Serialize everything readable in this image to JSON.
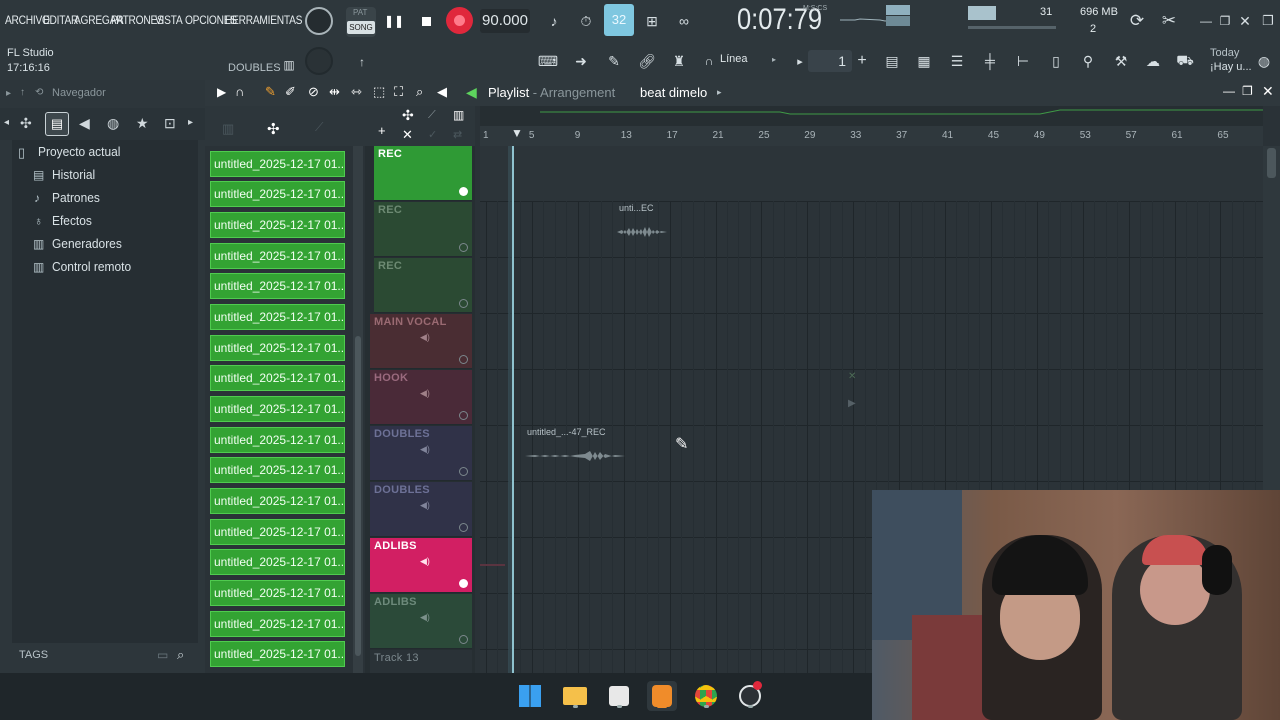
{
  "menu": [
    "ARCHIVO",
    "EDITAR",
    "AGREGAR",
    "PATRONES",
    "VISTA",
    "OPCIONES",
    "HERRAMIENTAS"
  ],
  "transport": {
    "pat": "PAT",
    "song": "SONG",
    "tempo": "90.000",
    "time": "0:07:79",
    "time_label": "M:S:CS",
    "pattern_num": "32"
  },
  "info": {
    "cpu": "31",
    "mem": "696 MB",
    "voices": "2"
  },
  "app": {
    "name": "FL Studio",
    "clock": "17:16:16",
    "hint_label": "DOUBLES"
  },
  "toolbar2": {
    "snap": "Línea",
    "num": "1",
    "today": "Today",
    "hint": "¡Hay u..."
  },
  "browser": {
    "title": "Navegador",
    "items": [
      "Proyecto actual",
      "Historial",
      "Patrones",
      "Efectos",
      "Generadores",
      "Control remoto"
    ],
    "tags": "TAGS"
  },
  "playlist": {
    "title": "Playlist",
    "sep": " - ",
    "section": "Arrangement",
    "pattern": "beat dimelo"
  },
  "ruler": [
    "1",
    "5",
    "9",
    "13",
    "17",
    "21",
    "25",
    "29",
    "33",
    "37",
    "41",
    "45",
    "49",
    "53",
    "57",
    "61",
    "65"
  ],
  "patterns": [
    "untitled_2025-12-17 01...",
    "untitled_2025-12-17 01...",
    "untitled_2025-12-17 01...",
    "untitled_2025-12-17 01...",
    "untitled_2025-12-17 01...",
    "untitled_2025-12-17 01...",
    "untitled_2025-12-17 01...",
    "untitled_2025-12-17 01...",
    "untitled_2025-12-17 01...",
    "untitled_2025-12-17 01...",
    "untitled_2025-12-17 01...",
    "untitled_2025-12-17 01...",
    "untitled_2025-12-17 01...",
    "untitled_2025-12-17 01...",
    "untitled_2025-12-17 01...",
    "untitled_2025-12-17 01...",
    "untitled_2025-12-17 01..."
  ],
  "tracks": [
    {
      "name": "REC",
      "color": "#2f9a35",
      "text": "#ffffff"
    },
    {
      "name": "REC",
      "color": "#2b4a33",
      "text": "#6d8a73"
    },
    {
      "name": "REC",
      "color": "#2b4a33",
      "text": "#6d8a73"
    },
    {
      "name": "MAIN VOCAL",
      "color": "#4a2d33",
      "text": "#9a6a72"
    },
    {
      "name": "HOOK",
      "color": "#4a2a38",
      "text": "#9a6a7e"
    },
    {
      "name": "DOUBLES",
      "color": "#303248",
      "text": "#6d7196"
    },
    {
      "name": "DOUBLES",
      "color": "#303248",
      "text": "#6d7196"
    },
    {
      "name": "ADLIBS",
      "color": "#d21f63",
      "text": "#ffffff"
    },
    {
      "name": "ADLIBS",
      "color": "#2b4a39",
      "text": "#6d8a7b"
    },
    {
      "name": "Track 13",
      "color": "#2a3237",
      "text": "#7b878c"
    }
  ],
  "clips": {
    "clip1": "unti...EC",
    "clip2": "untitled_...-47_REC"
  },
  "colors": {
    "accent": "#33a333",
    "record": "#e0283c",
    "adlibs": "#d21f63"
  }
}
